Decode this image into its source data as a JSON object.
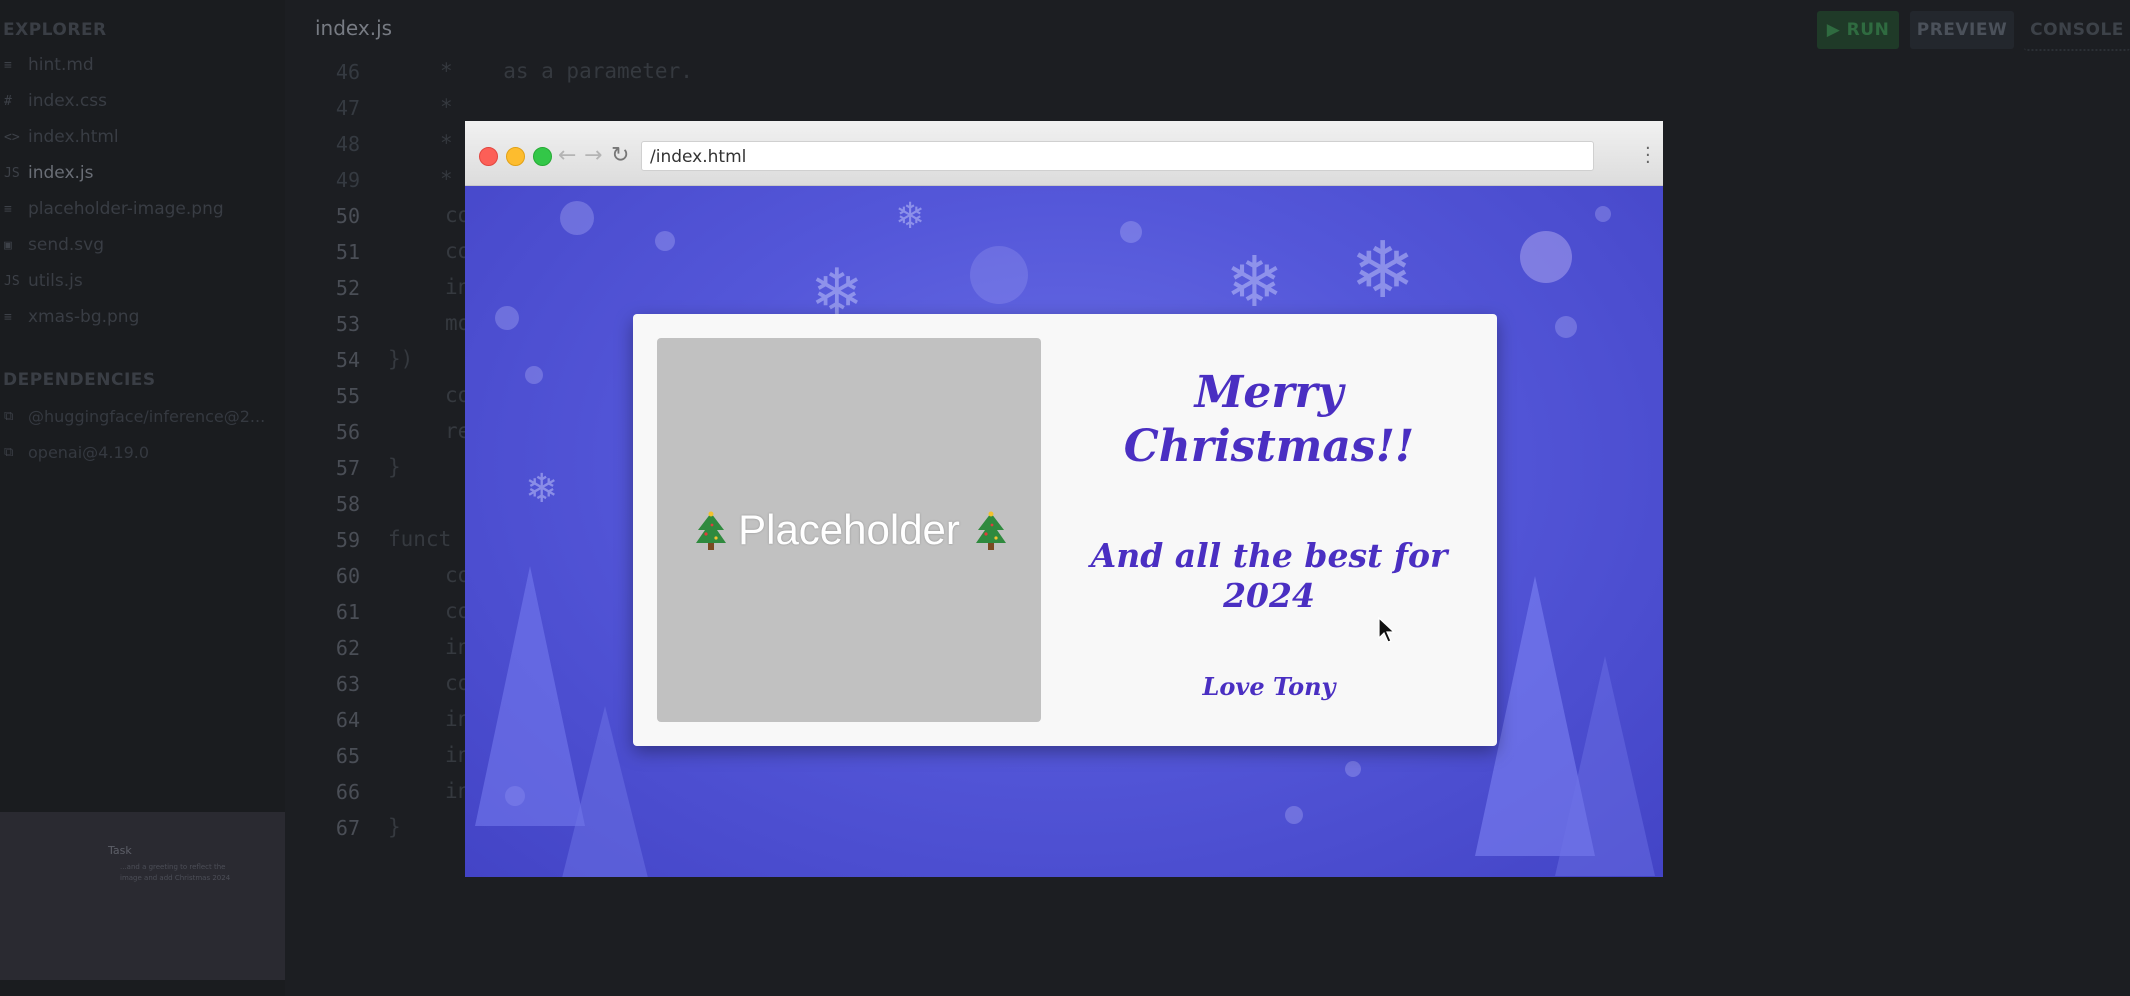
{
  "sidebar": {
    "explorer_heading": "EXPLORER",
    "files": [
      {
        "icon": "≡",
        "name": "hint.md"
      },
      {
        "icon": "#",
        "name": "index.css"
      },
      {
        "icon": "<>",
        "name": "index.html"
      },
      {
        "icon": "JS",
        "name": "index.js"
      },
      {
        "icon": "≡",
        "name": "placeholder-image.png"
      },
      {
        "icon": "▣",
        "name": "send.svg"
      },
      {
        "icon": "JS",
        "name": "utils.js"
      },
      {
        "icon": "≡",
        "name": "xmas-bg.png"
      }
    ],
    "dependencies_heading": "DEPENDENCIES",
    "dependencies": [
      "@huggingface/inference@2...",
      "openai@4.19.0"
    ],
    "thumbnail": {
      "title": "Task",
      "text": "...and a greeting to reflect the image and add Christmas 2024"
    }
  },
  "editor": {
    "tab": "index.js",
    "line_numbers": [
      "46",
      "47",
      "48",
      "49",
      "50",
      "51",
      "52",
      "53",
      "54",
      "55",
      "56",
      "57",
      "58",
      "59",
      "60",
      "61",
      "62",
      "63",
      "64",
      "65",
      "66",
      "67"
    ],
    "code_lines": [
      "*    as a parameter.",
      "*",
      "*",
      "*",
      "co",
      "co",
      "in",
      "mo",
      "})",
      "co",
      "re",
      "}",
      "",
      "funct",
      "co",
      "co",
      "in",
      "co",
      "in",
      "in",
      "in",
      "}"
    ]
  },
  "toolbar": {
    "run_label": "▶ RUN",
    "preview_label": "PREVIEW",
    "console_label": "CONSOLE"
  },
  "browser": {
    "url": "/index.html",
    "back_icon": "←",
    "forward_icon": "→",
    "reload_icon": "↻"
  },
  "card": {
    "placeholder_text": "Placeholder",
    "greeting_title": "Merry Christmas!!",
    "greeting_sub": "And all the best for 2024",
    "signature": "Love Tony"
  },
  "colors": {
    "greeting": "#4a2fc2",
    "background_accent": "#5457d9"
  }
}
